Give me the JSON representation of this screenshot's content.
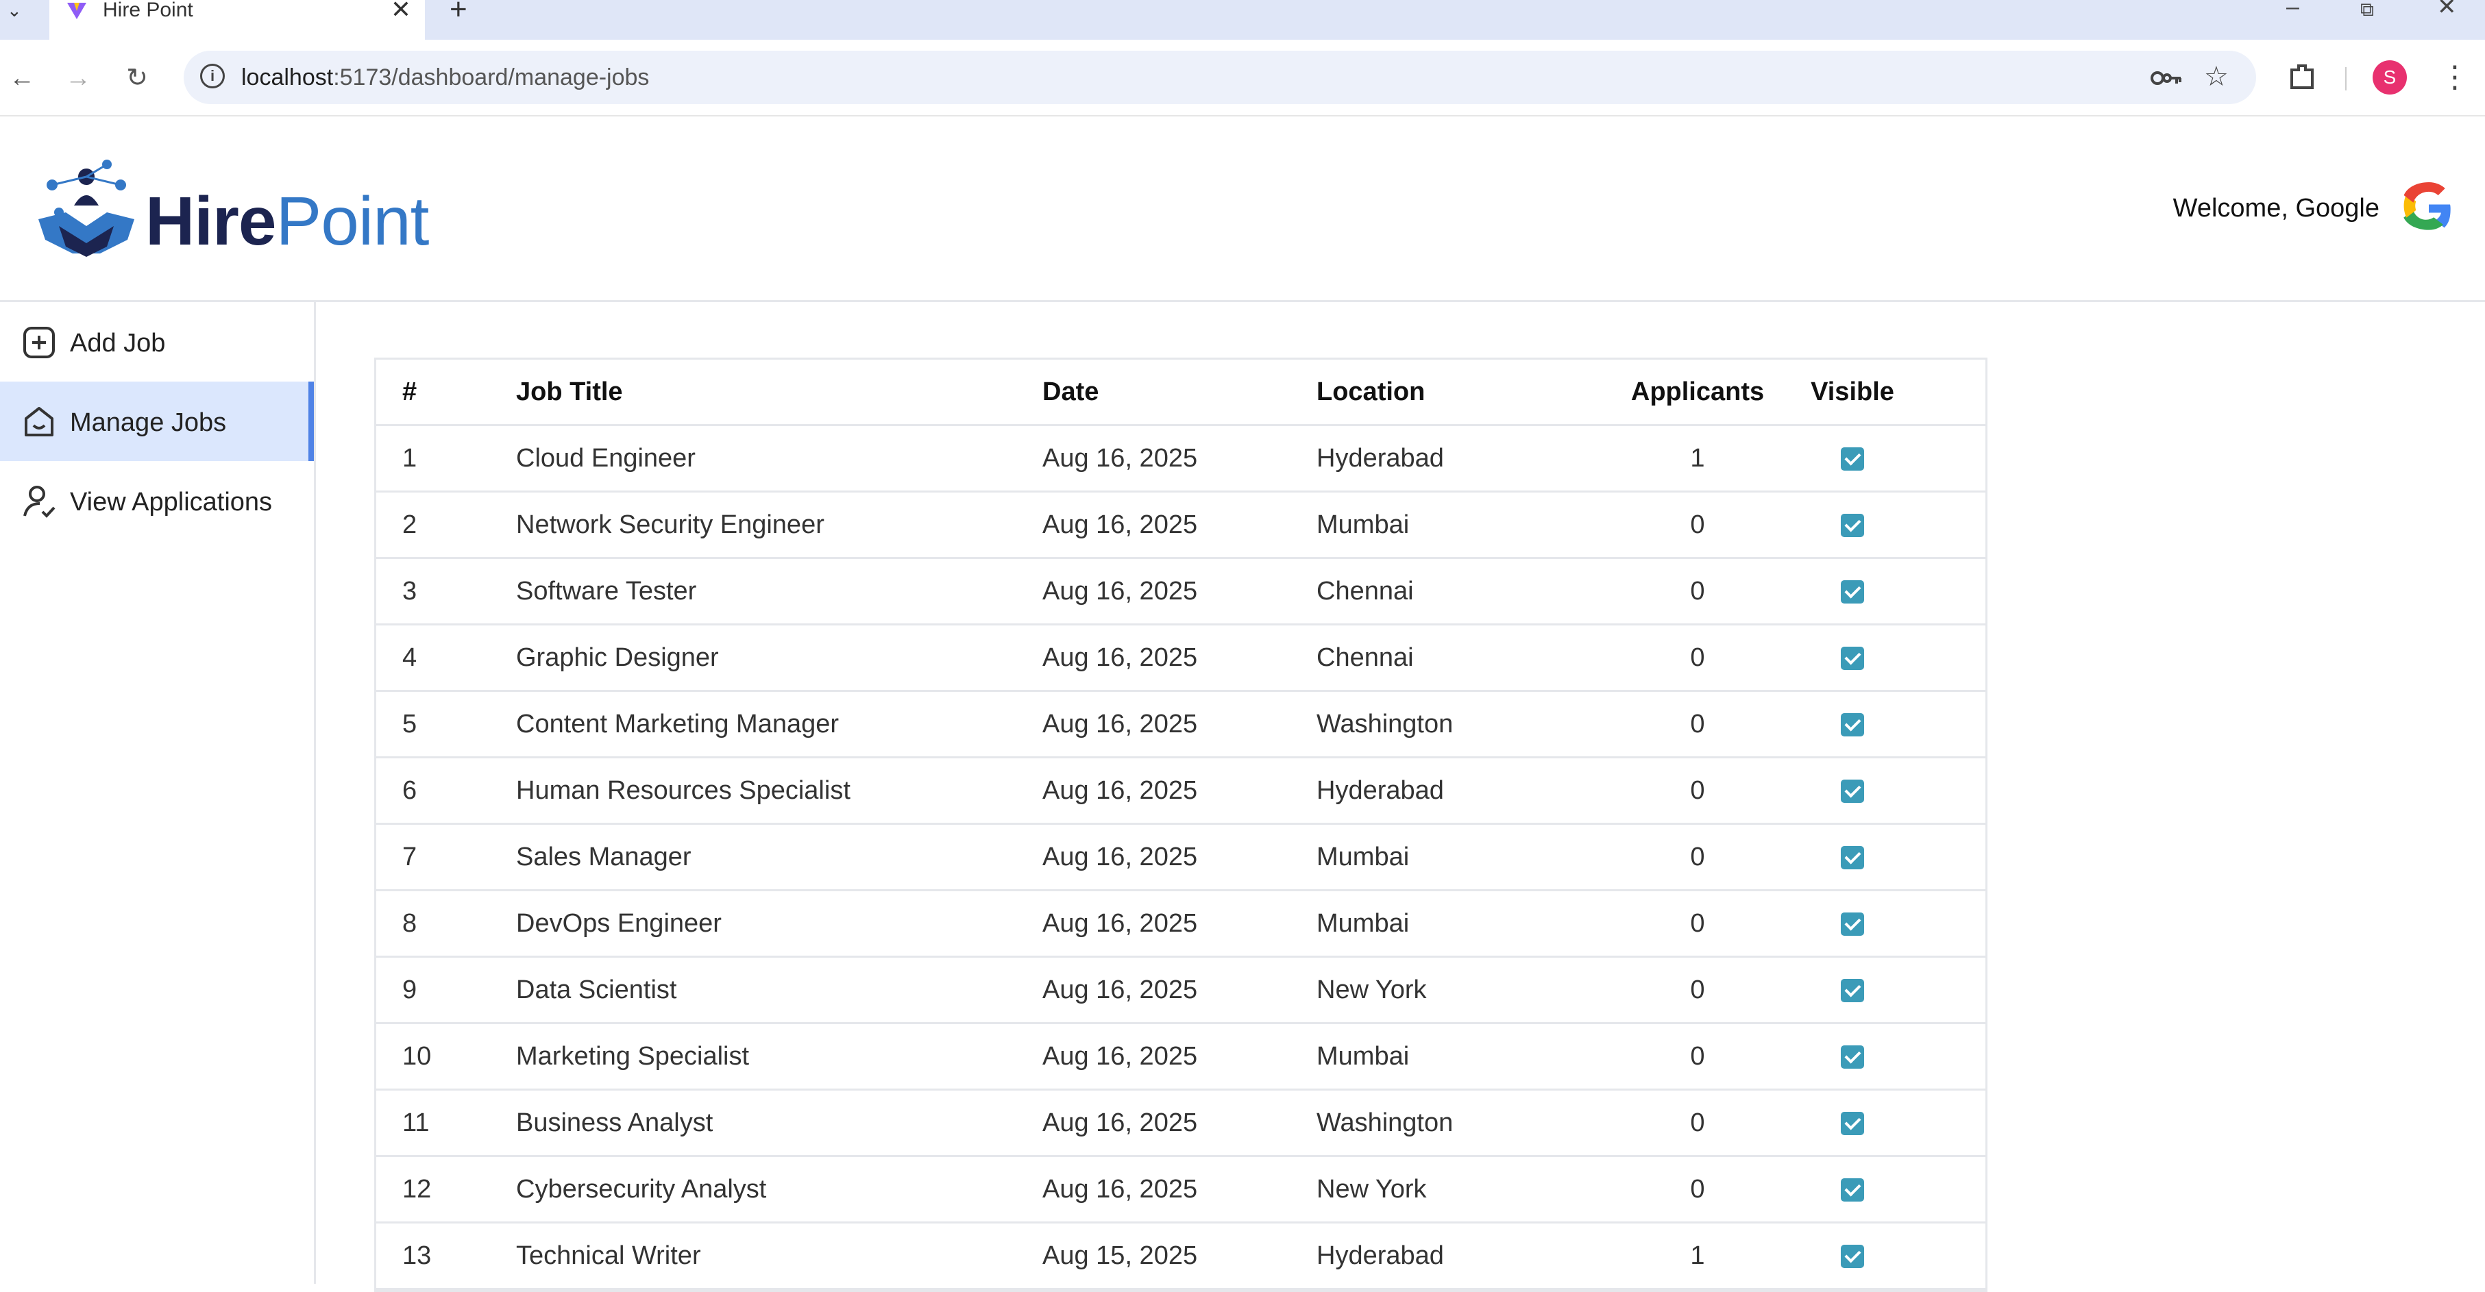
{
  "browser": {
    "tab_title": "Hire Point",
    "url_host": "localhost",
    "url_rest": ":5173/dashboard/manage-jobs",
    "profile_initial": "S"
  },
  "header": {
    "logo_part1": "Hire",
    "logo_part2": "Point",
    "welcome": "Welcome, Google"
  },
  "sidebar": {
    "items": [
      {
        "label": "Add Job",
        "icon": "plus-square-icon",
        "active": false
      },
      {
        "label": "Manage Jobs",
        "icon": "home-icon",
        "active": true
      },
      {
        "label": "View Applications",
        "icon": "person-check-icon",
        "active": false
      }
    ]
  },
  "table": {
    "headers": [
      "#",
      "Job Title",
      "Date",
      "Location",
      "Applicants",
      "Visible"
    ],
    "rows": [
      {
        "num": "1",
        "title": "Cloud Engineer",
        "date": "Aug 16, 2025",
        "location": "Hyderabad",
        "applicants": "1",
        "visible": true
      },
      {
        "num": "2",
        "title": "Network Security Engineer",
        "date": "Aug 16, 2025",
        "location": "Mumbai",
        "applicants": "0",
        "visible": true
      },
      {
        "num": "3",
        "title": "Software Tester",
        "date": "Aug 16, 2025",
        "location": "Chennai",
        "applicants": "0",
        "visible": true
      },
      {
        "num": "4",
        "title": "Graphic Designer",
        "date": "Aug 16, 2025",
        "location": "Chennai",
        "applicants": "0",
        "visible": true
      },
      {
        "num": "5",
        "title": "Content Marketing Manager",
        "date": "Aug 16, 2025",
        "location": "Washington",
        "applicants": "0",
        "visible": true
      },
      {
        "num": "6",
        "title": "Human Resources Specialist",
        "date": "Aug 16, 2025",
        "location": "Hyderabad",
        "applicants": "0",
        "visible": true
      },
      {
        "num": "7",
        "title": "Sales Manager",
        "date": "Aug 16, 2025",
        "location": "Mumbai",
        "applicants": "0",
        "visible": true
      },
      {
        "num": "8",
        "title": "DevOps Engineer",
        "date": "Aug 16, 2025",
        "location": "Mumbai",
        "applicants": "0",
        "visible": true
      },
      {
        "num": "9",
        "title": "Data Scientist",
        "date": "Aug 16, 2025",
        "location": "New York",
        "applicants": "0",
        "visible": true
      },
      {
        "num": "10",
        "title": "Marketing Specialist",
        "date": "Aug 16, 2025",
        "location": "Mumbai",
        "applicants": "0",
        "visible": true
      },
      {
        "num": "11",
        "title": "Business Analyst",
        "date": "Aug 16, 2025",
        "location": "Washington",
        "applicants": "0",
        "visible": true
      },
      {
        "num": "12",
        "title": "Cybersecurity Analyst",
        "date": "Aug 16, 2025",
        "location": "New York",
        "applicants": "0",
        "visible": true
      },
      {
        "num": "13",
        "title": "Technical Writer",
        "date": "Aug 15, 2025",
        "location": "Hyderabad",
        "applicants": "1",
        "visible": true
      }
    ]
  },
  "colors": {
    "accent": "#4f82e6",
    "active_bg": "#dbe7fd",
    "checkbox": "#3b9bb8",
    "logo_dark": "#1c2450",
    "logo_blue": "#3478c6"
  }
}
